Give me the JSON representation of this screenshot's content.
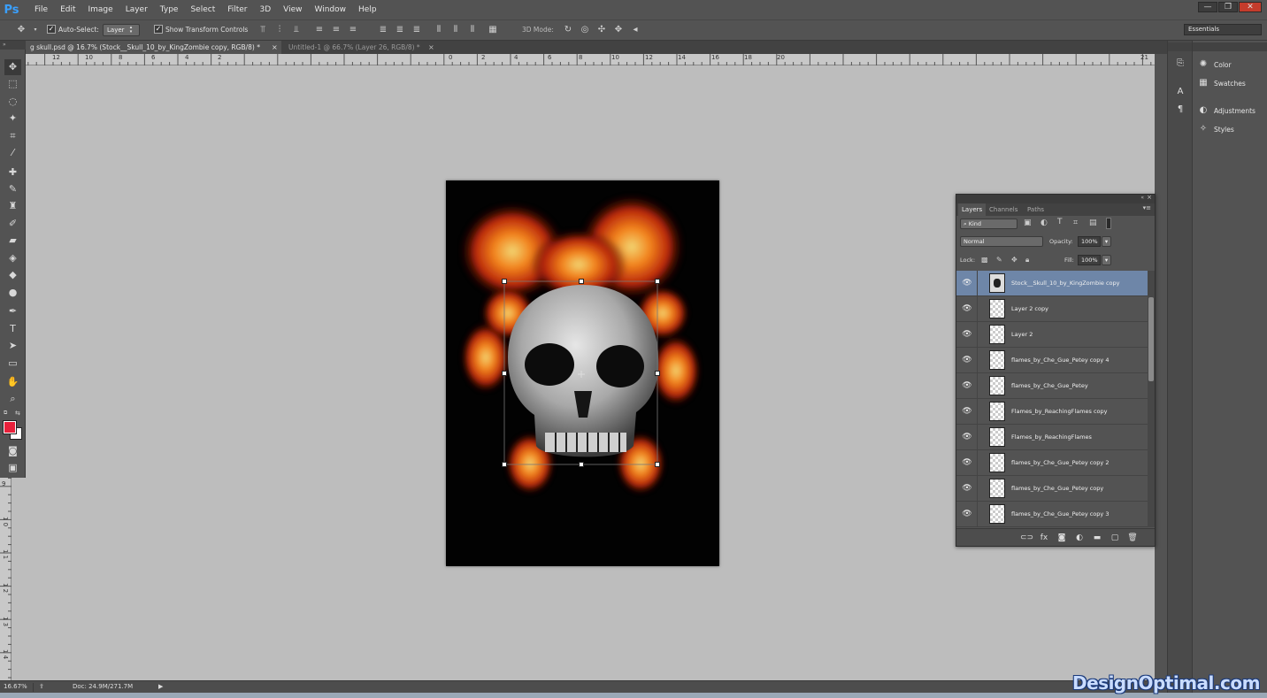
{
  "app": {
    "logo": "Ps"
  },
  "menu": [
    "File",
    "Edit",
    "Image",
    "Layer",
    "Type",
    "Select",
    "Filter",
    "3D",
    "View",
    "Window",
    "Help"
  ],
  "window_controls": [
    "—",
    "❐",
    "✕"
  ],
  "options_bar": {
    "auto_select_label": "Auto-Select:",
    "auto_select_value": "Layer",
    "transform_controls_label": "Show Transform Controls",
    "mode_3d_label": "3D Mode:",
    "workspace": "Essentials"
  },
  "tabs": [
    {
      "title": "g skull.psd @ 16.7% (Stock__Skull_10_by_KingZombie copy, RGB/8) *",
      "active": true
    },
    {
      "title": "Untitled-1 @ 66.7% (Layer 26, RGB/8) *",
      "active": false
    }
  ],
  "rulers": {
    "horizontal": [
      "12",
      "10",
      "8",
      "6",
      "4",
      "2",
      "0",
      "2",
      "4",
      "6",
      "8",
      "10",
      "12",
      "14",
      "16",
      "18",
      "20",
      "21"
    ],
    "vertical": [
      "1",
      "0",
      "1",
      "2",
      "3",
      "4",
      "5",
      "6",
      "7",
      "8",
      "9",
      "1 0",
      "1 1",
      "1 2",
      "1 3",
      "1 4"
    ]
  },
  "right_dock": [
    {
      "label": "Color",
      "icon": "color-wheel-icon"
    },
    {
      "label": "Swatches",
      "icon": "grid-icon"
    },
    {
      "label": "Adjustments",
      "icon": "half-circle-icon"
    },
    {
      "label": "Styles",
      "icon": "fx-icon"
    }
  ],
  "layers_panel": {
    "tabs": [
      "Layers",
      "Channels",
      "Paths"
    ],
    "kind": "Kind",
    "blend_mode": "Normal",
    "opacity_label": "Opacity:",
    "opacity_value": "100%",
    "lock_label": "Lock:",
    "fill_label": "Fill:",
    "fill_value": "100%",
    "layers": [
      {
        "name": "Stock__Skull_10_by_KingZombie copy",
        "selected": true
      },
      {
        "name": "Layer 2 copy",
        "selected": false
      },
      {
        "name": "Layer 2",
        "selected": false
      },
      {
        "name": "flames_by_Che_Gue_Petey copy 4",
        "selected": false
      },
      {
        "name": "flames_by_Che_Gue_Petey",
        "selected": false
      },
      {
        "name": "Flames_by_ReachingFlames copy",
        "selected": false
      },
      {
        "name": "Flames_by_ReachingFlames",
        "selected": false
      },
      {
        "name": "flames_by_Che_Gue_Petey copy 2",
        "selected": false
      },
      {
        "name": "flames_by_Che_Gue_Petey copy",
        "selected": false
      },
      {
        "name": "flames_by_Che_Gue_Petey copy 3",
        "selected": false
      }
    ]
  },
  "status": {
    "zoom": "16.67%",
    "doc": "Doc: 24.9M/271.7M"
  },
  "watermark": "DesignOptimal.com",
  "colors": {
    "foreground": "#e8203a",
    "background": "#ffffff",
    "selection": "#6e86a8"
  }
}
